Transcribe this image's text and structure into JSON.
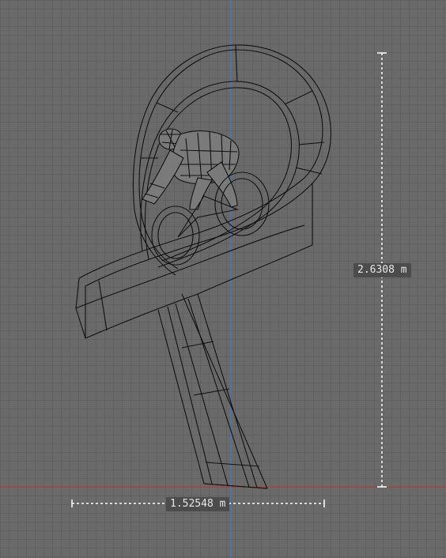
{
  "viewport": {
    "name": "3D modeling viewport",
    "background_color": "#6a6a6a",
    "grid_color": "#5d5d5d",
    "x_axis_color": "#c0392b",
    "z_axis_color": "#3f7bd1",
    "wireframe_color": "#111111"
  },
  "measurements": {
    "height": {
      "label": "2.6308 m"
    },
    "width": {
      "label": "1.52548 m"
    }
  },
  "objects": [
    {
      "name": "ribbon-loop-sculpture"
    },
    {
      "name": "cyclist-figure"
    }
  ]
}
